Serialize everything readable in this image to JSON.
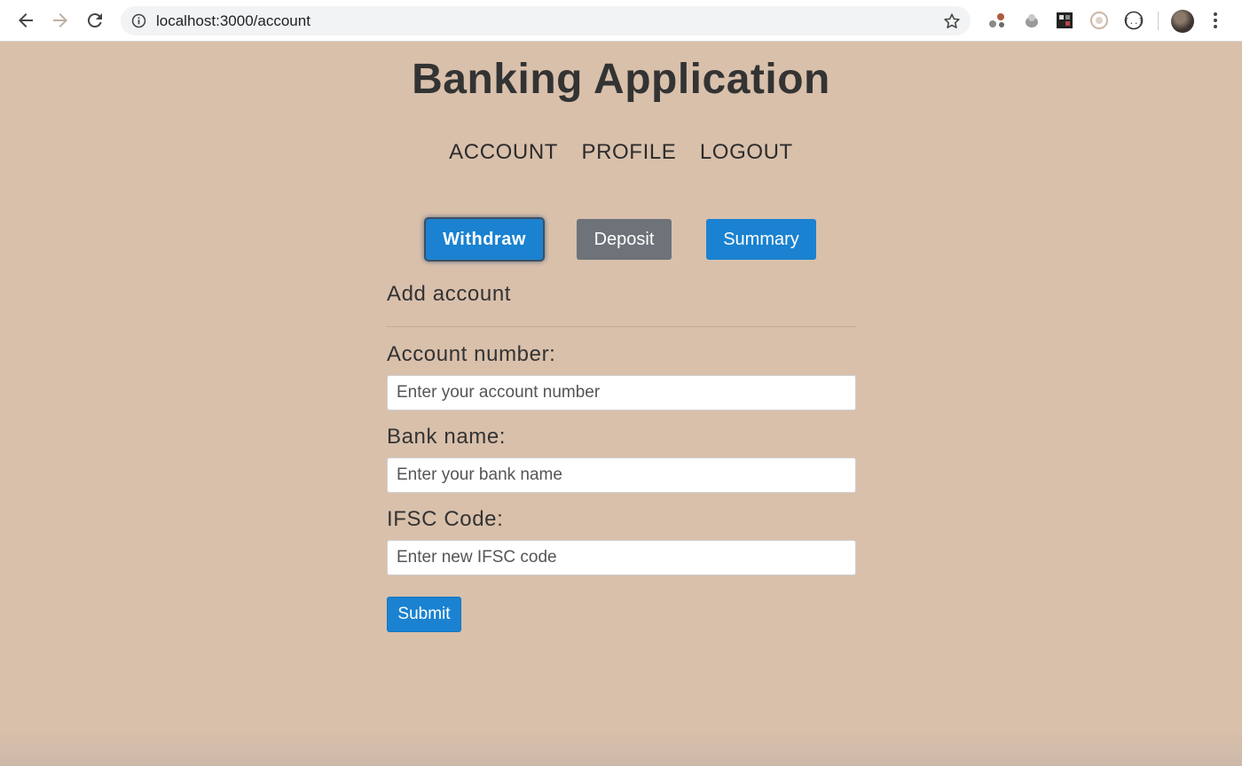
{
  "browser": {
    "url_host": "localhost",
    "url_rest": ":3000/account"
  },
  "app": {
    "title": "Banking Application"
  },
  "nav": {
    "account": "ACCOUNT",
    "profile": "PROFILE",
    "logout": "LOGOUT"
  },
  "actions": {
    "withdraw": "Withdraw",
    "deposit": "Deposit",
    "summary": "Summary"
  },
  "form": {
    "title": "Add account",
    "account_number_label": "Account number:",
    "account_number_placeholder": "Enter your account number",
    "bank_name_label": "Bank name:",
    "bank_name_placeholder": "Enter your bank name",
    "ifsc_label": "IFSC Code:",
    "ifsc_placeholder": "Enter new IFSC code",
    "submit": "Submit"
  },
  "colors": {
    "page_background": "#d9c0ab",
    "primary": "#1a82d0",
    "secondary": "#6d7379"
  }
}
